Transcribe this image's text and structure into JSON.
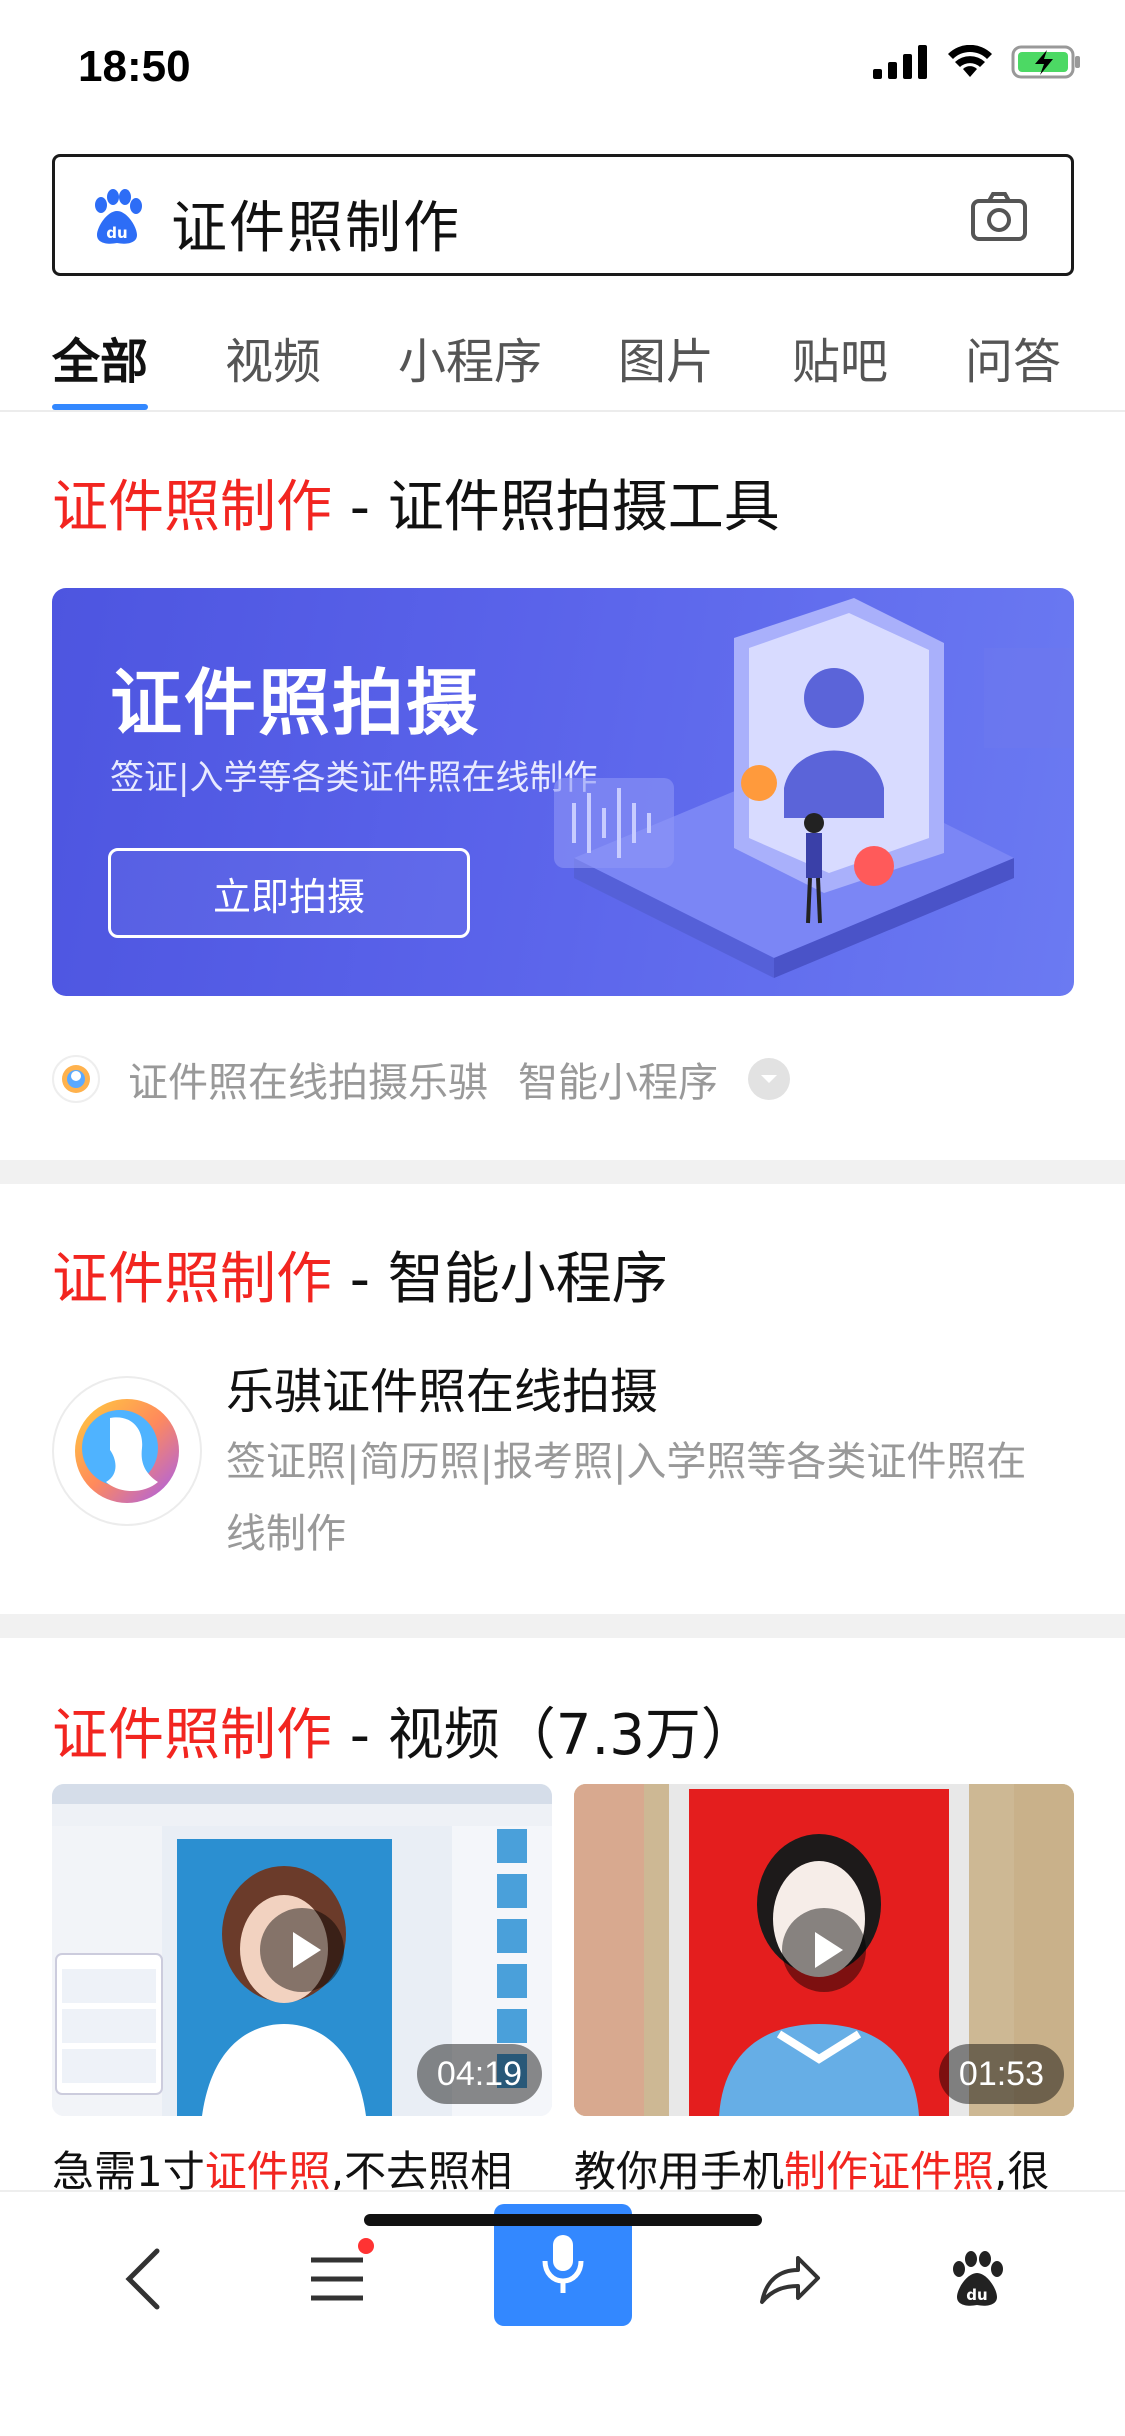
{
  "status_bar": {
    "time": "18:50"
  },
  "search": {
    "query": "证件照制作"
  },
  "tabs": [
    {
      "label": "全部",
      "active": true
    },
    {
      "label": "视频",
      "active": false
    },
    {
      "label": "小程序",
      "active": false
    },
    {
      "label": "图片",
      "active": false
    },
    {
      "label": "贴吧",
      "active": false
    },
    {
      "label": "问答",
      "active": false
    }
  ],
  "result1": {
    "title_highlight": "证件照制作",
    "title_rest": " - 证件照拍摄工具",
    "banner_title": "证件照拍摄",
    "banner_subtitle": "签证|入学等各类证件照在线制作",
    "banner_button": "立即拍摄",
    "source_name": "证件照在线拍摄乐骐",
    "source_type": "智能小程序"
  },
  "result2": {
    "title_highlight": "证件照制作",
    "title_rest": " - 智能小程序",
    "app_name": "乐骐证件照在线拍摄",
    "app_desc": "签证照|简历照|报考照|入学照等各类证件照在线制作"
  },
  "result3": {
    "title_highlight": "证件照制作",
    "title_rest": " - 视频（7.3万）",
    "videos": [
      {
        "duration": "04:19",
        "caption_pre": "急需1寸",
        "caption_hl": "证件照",
        "caption_post": ",不去照相"
      },
      {
        "duration": "01:53",
        "caption_pre": "教你用手机",
        "caption_hl": "制作证件照",
        "caption_post": ",很"
      }
    ]
  },
  "colors": {
    "accent": "#3388ff",
    "highlight": "#f22520",
    "banner": "#5a63ea"
  }
}
